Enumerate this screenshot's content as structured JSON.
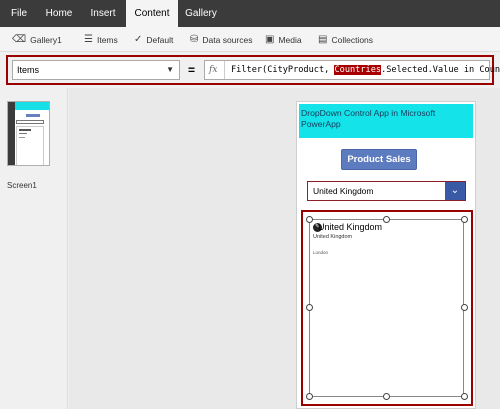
{
  "menu": {
    "tabs": [
      {
        "label": "File"
      },
      {
        "label": "Home"
      },
      {
        "label": "Insert"
      },
      {
        "label": "Content"
      },
      {
        "label": "Gallery"
      }
    ],
    "active_tab": "Content"
  },
  "ribbon": {
    "gallery": "Gallery1",
    "items": "Items",
    "default": "Default",
    "data_sources": "Data sources",
    "media": "Media",
    "collections": "Collections"
  },
  "formula": {
    "property": "Items",
    "equals": "=",
    "fx": "fx",
    "part1": "Filter(CityProduct, ",
    "highlight": "Countries",
    "part2": ".Selected.Value in Country)"
  },
  "screens": {
    "label": "Screen1"
  },
  "app": {
    "title": "DropDown Control App in Microsoft PowerApp",
    "button": "Product Sales",
    "dropdown_value": "United Kingdom",
    "gallery_title": "United Kingdom",
    "gallery_subtitle": "United Kingdom",
    "gallery_city": "London"
  },
  "colors": {
    "accent_red": "#9b0000",
    "header_cyan": "#14e3ea",
    "button_blue": "#5d7bbf",
    "menubar": "#3b3b3b"
  }
}
